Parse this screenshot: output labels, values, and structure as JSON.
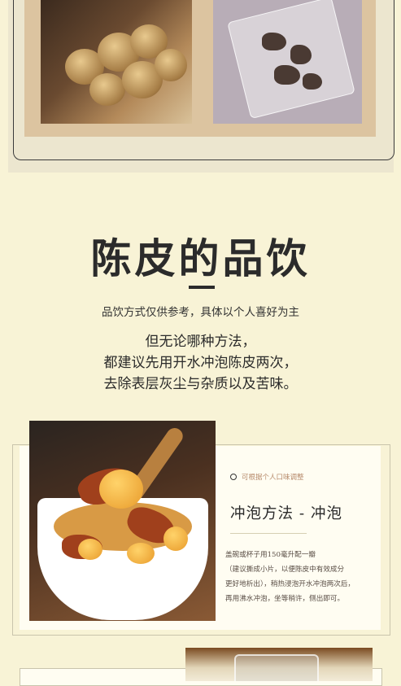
{
  "heading": {
    "title": "陈皮的品饮",
    "subtitle": "品饮方式仅供参考，具体以个人喜好为主",
    "paragraph": [
      "但无论哪种方法，",
      "都建议先用开水冲泡陈皮两次，",
      "去除表层灰尘与杂质以及苦味。"
    ]
  },
  "method": {
    "tip": "可根据个人口味调整",
    "title": "冲泡方法 - 冲泡",
    "lines": [
      "盖碗或杯子用150毫升配一瓣",
      "（建议撕成小片，以便陈皮中有效成分",
      "更好地析出），稍热浸泡开水冲泡两次后，",
      "再用沸水冲泡，坐等稍许，侧出即可。"
    ]
  },
  "colors": {
    "background": "#f8f3d6",
    "accent": "#2b2b2b",
    "tip_text": "#b6896a"
  }
}
